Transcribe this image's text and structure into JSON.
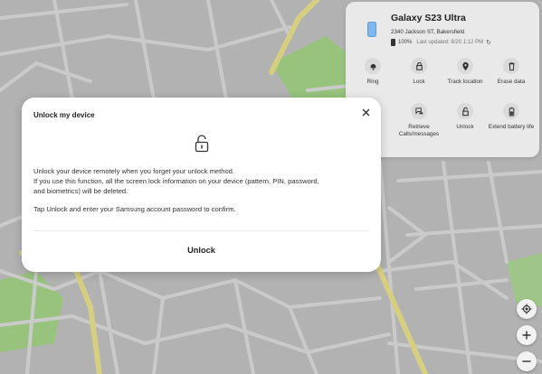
{
  "device": {
    "name": "Galaxy S23 Ultra",
    "address": "2340 Jackson ST, Bakersfield",
    "battery": "100%",
    "last_updated": "Last updated: 8/20 1:12 PM"
  },
  "actions": [
    {
      "label": "Ring",
      "icon": "ring-icon"
    },
    {
      "label": "Lock",
      "icon": "lock-icon"
    },
    {
      "label": "Track location",
      "icon": "location-pin-icon"
    },
    {
      "label": "Erase data",
      "icon": "trash-icon"
    },
    {
      "label": "Retrieve Calls/messages",
      "icon": "messages-icon"
    },
    {
      "label": "Unlock",
      "icon": "unlock-icon"
    },
    {
      "label": "Extend battery life",
      "icon": "battery-icon"
    }
  ],
  "modal": {
    "title": "Unlock my device",
    "line1": "Unlock your device remotely when you forget your unlock method.",
    "line2": "If you use this function, all the screen lock information on your device (pattern, PIN, password,",
    "line3": "and biometrics) will be deleted.",
    "line4": "Tap Unlock and enter your Samsung account password to confirm.",
    "unlock_button": "Unlock"
  },
  "map_controls": [
    "my-location-icon",
    "zoom-in-icon",
    "zoom-out-icon"
  ],
  "colors": {
    "map_bg": "#bdbdbd",
    "road": "#d3d3d3",
    "highway": "#e5df8a",
    "park": "#9fcf83"
  }
}
